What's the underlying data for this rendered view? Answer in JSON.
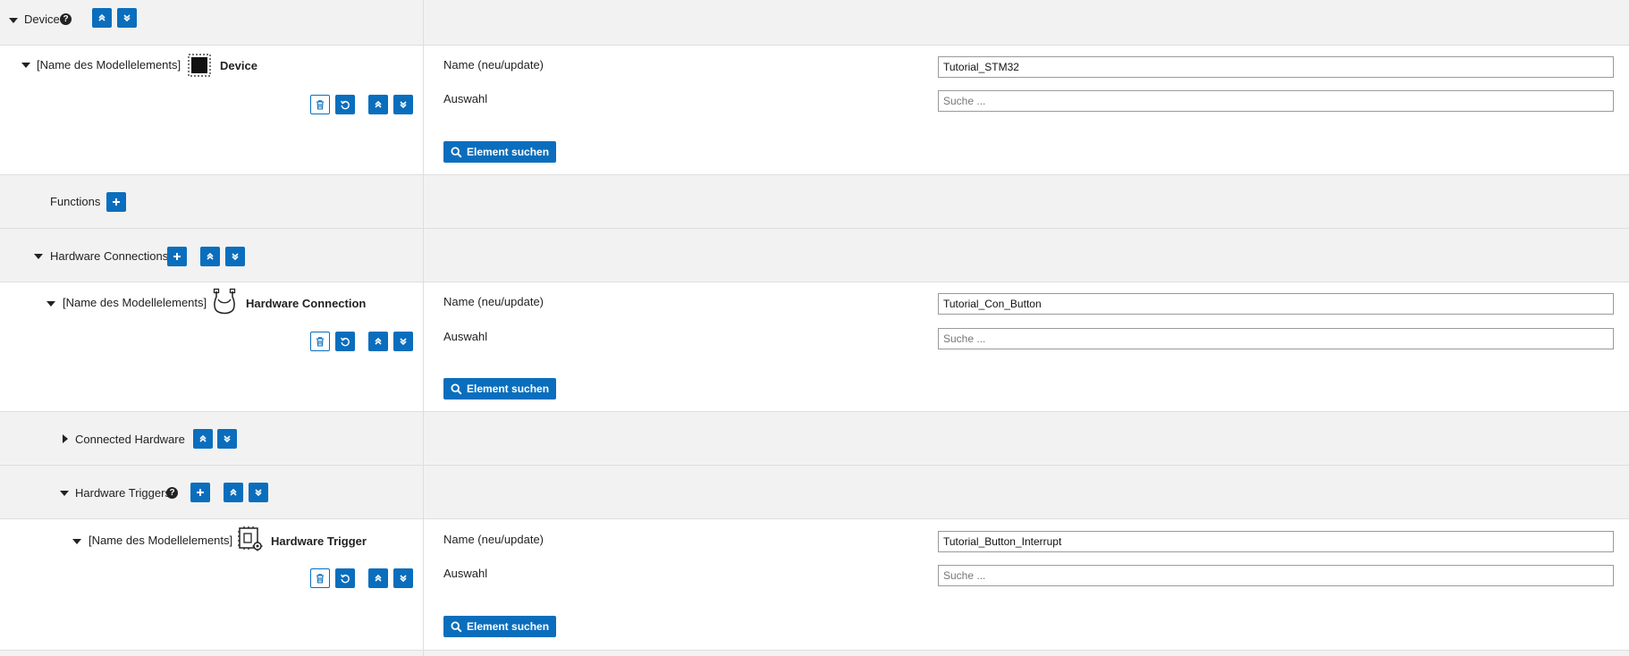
{
  "device_section": {
    "title": "Device",
    "help": "?"
  },
  "device_element": {
    "name_label": "[Name des Modellelements]",
    "type": "Device",
    "field_name_label": "Name (neu/update)",
    "field_name_value": "Tutorial_STM32",
    "field_select_label": "Auswahl",
    "field_select_placeholder": "Suche ...",
    "search_button": "Element suchen"
  },
  "functions_section": {
    "title": "Functions"
  },
  "hw_connections_section": {
    "title": "Hardware Connections"
  },
  "hw_connection_element": {
    "name_label": "[Name des Modellelements]",
    "type": "Hardware Connection",
    "field_name_label": "Name (neu/update)",
    "field_name_value": "Tutorial_Con_Button",
    "field_select_label": "Auswahl",
    "field_select_placeholder": "Suche ...",
    "search_button": "Element suchen"
  },
  "connected_hardware_section": {
    "title": "Connected Hardware"
  },
  "hw_triggers_section": {
    "title": "Hardware Triggers",
    "help": "?"
  },
  "hw_trigger_element": {
    "name_label": "[Name des Modellelements]",
    "type": "Hardware Trigger",
    "field_name_label": "Name (neu/update)",
    "field_name_value": "Tutorial_Button_Interrupt",
    "field_select_label": "Auswahl",
    "field_select_placeholder": "Suche ...",
    "search_button": "Element suchen"
  },
  "colors": {
    "accent": "#0a6ebd",
    "row_gray": "#f2f2f2",
    "border": "#dedede"
  },
  "icons": {
    "collapse_all": "double-chevron-up-icon",
    "expand_all": "double-chevron-down-icon",
    "add": "plus-icon",
    "delete": "trash-icon",
    "reset": "reset-icon",
    "search": "magnifier-icon"
  }
}
